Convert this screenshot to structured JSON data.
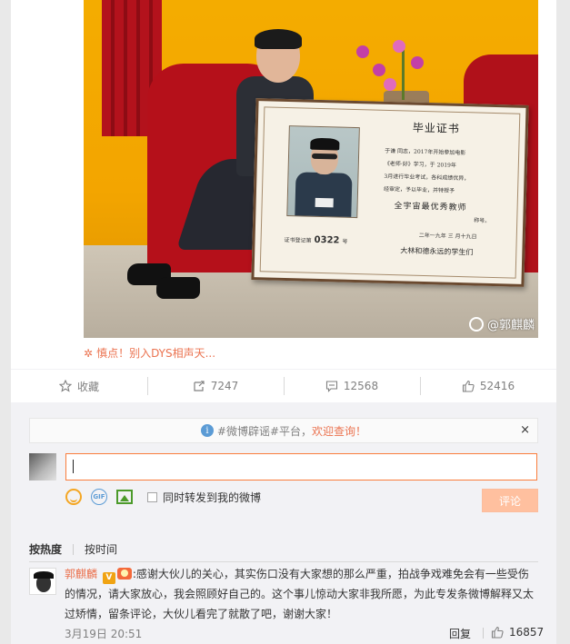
{
  "post": {
    "watermark": "@郭麒麟",
    "certificate": {
      "title": "毕业证书",
      "line1": "于谦 同志，2017年开始参加电影",
      "line2": "《老师·好》学习，于 2019年",
      "line3": "3月进行毕业考试，各科成绩优异，",
      "line4": "经审定，予以毕业，并特授予",
      "honor": "全宇宙最优秀教师",
      "honor_suffix": "称号。",
      "date": "二年一九年 三 月十九日",
      "reg_prefix": "证书登记第",
      "reg_number": "0322",
      "reg_suffix": "号",
      "signature": "大林和德永远的学生们"
    },
    "tagline": "慎点！别入DYS相声天..."
  },
  "actions": [
    {
      "label": "收藏",
      "icon": "star-icon"
    },
    {
      "label": "7247",
      "icon": "repost-icon"
    },
    {
      "label": "12568",
      "icon": "comment-icon"
    },
    {
      "label": "52416",
      "icon": "like-icon"
    }
  ],
  "notice": {
    "prefix": "#微博辟谣#平台，",
    "accent": "欢迎查询！",
    "close": "×"
  },
  "composer": {
    "placeholder": "",
    "repost_label": "同时转发到我的微博",
    "submit": "评论"
  },
  "sort": {
    "hot": "按热度",
    "time": "按时间"
  },
  "comment": {
    "user": "郭麒麟",
    "v_badge": "V",
    "text": ":感谢大伙儿的关心，其实伤口没有大家想的那么严重，拍战争戏难免会有一些受伤的情况，请大家放心，我会照顾好自己的。这个事儿惊动大家非我所愿，为此专发条微博解释又太过矫情，留条评论，大伙儿看完了就散了吧，谢谢大家！",
    "time": "3月19日 20:51",
    "reply": "回复",
    "likes": "16857"
  }
}
